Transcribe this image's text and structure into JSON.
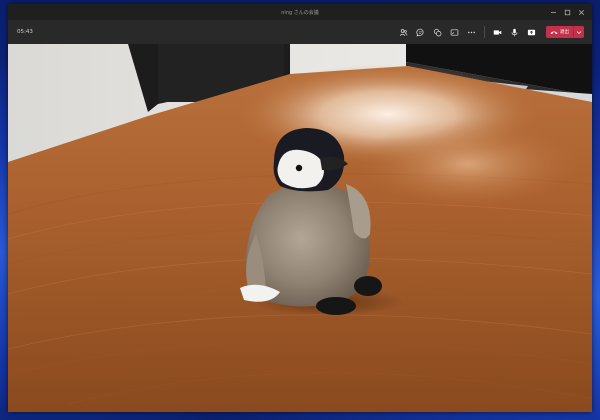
{
  "window": {
    "title": "ning さんの会議",
    "controls": {
      "minimize_icon": "minimize-icon",
      "maximize_icon": "maximize-icon",
      "close_icon": "close-icon"
    }
  },
  "toolbar": {
    "timer": "05:43",
    "buttons": [
      {
        "name": "people-icon"
      },
      {
        "name": "chat-icon"
      },
      {
        "name": "reactions-icon"
      },
      {
        "name": "rooms-icon"
      },
      {
        "name": "more-icon"
      },
      {
        "name": "camera-icon"
      },
      {
        "name": "mic-icon"
      },
      {
        "name": "share-icon"
      }
    ],
    "leave_label": "退出"
  },
  "colors": {
    "leave_button": "#c4314b",
    "toolbar_bg": "#292929",
    "titlebar_bg": "#1f1f1f"
  }
}
